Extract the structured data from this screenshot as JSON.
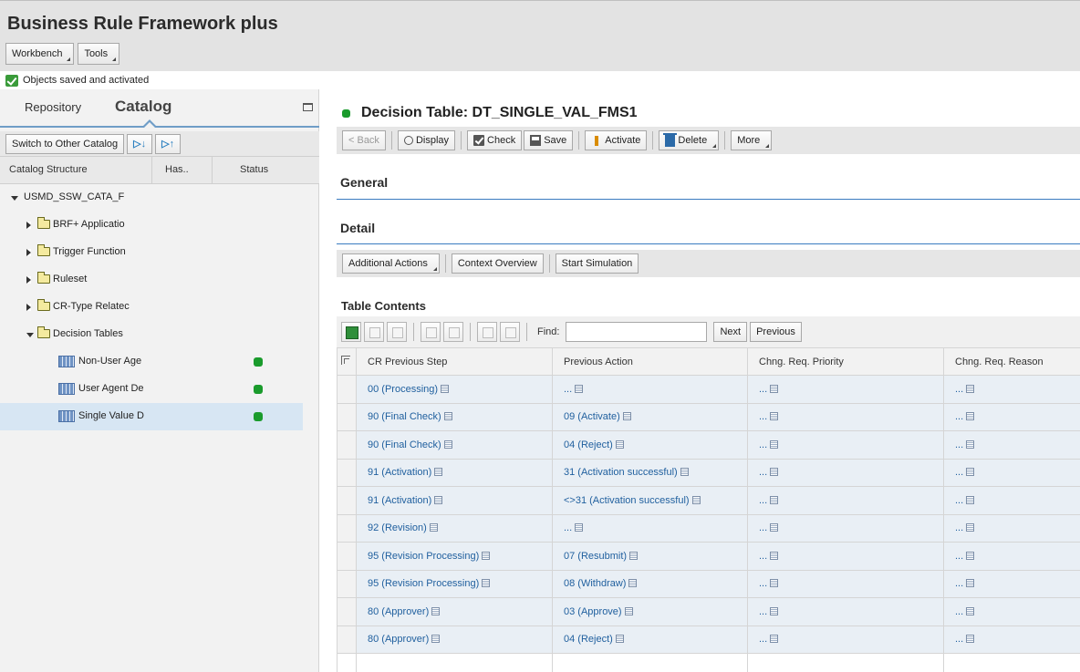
{
  "app": {
    "title": "Business Rule Framework plus",
    "menus": [
      "Workbench",
      "Tools"
    ],
    "status_message": "Objects saved and activated"
  },
  "left": {
    "tab_repository": "Repository",
    "tab_catalog": "Catalog",
    "switch_catalog_label": "Switch to Other Catalog",
    "columns": {
      "structure": "Catalog Structure",
      "has": "Has..",
      "status": "Status"
    },
    "tree": {
      "root": "USMD_SSW_CATA_F",
      "folders": [
        "BRF+ Applicatio",
        "Trigger Function",
        "Ruleset",
        "CR-Type Relatec",
        "Decision Tables"
      ],
      "tables": [
        "Non-User Age",
        "User Agent Dе",
        "Single Value D"
      ]
    }
  },
  "right": {
    "doc_title": "Decision Table: DT_SINGLE_VAL_FMS1",
    "toolbar": {
      "back": "< Back",
      "display": "Display",
      "check": "Check",
      "save": "Save",
      "activate": "Activate",
      "delete": "Delete",
      "more": "More"
    },
    "section_general": "General",
    "section_detail": "Detail",
    "detail_toolbar": {
      "additional_actions": "Additional Actions",
      "context_overview": "Context Overview",
      "start_simulation": "Start Simulation"
    },
    "table_contents_title": "Table Contents",
    "find_label": "Find:",
    "find_value": "",
    "next_label": "Next",
    "previous_label": "Previous",
    "table": {
      "headers": [
        "CR Previous Step",
        "Previous Action",
        "Chng. Req. Priority",
        "Chng. Req. Reason"
      ],
      "rows": [
        [
          "00 (Processing)",
          "...",
          "...",
          "..."
        ],
        [
          "90 (Final Check)",
          "09 (Activate)",
          "...",
          "..."
        ],
        [
          "90 (Final Check)",
          "04 (Reject)",
          "...",
          "..."
        ],
        [
          "91 (Activation)",
          "31 (Activation successful)",
          "...",
          "..."
        ],
        [
          "91 (Activation)",
          "<>31 (Activation successful)",
          "...",
          "..."
        ],
        [
          "92 (Revision)",
          "...",
          "...",
          "..."
        ],
        [
          "95 (Revision Processing)",
          "07 (Resubmit)",
          "...",
          "..."
        ],
        [
          "95 (Revision Processing)",
          "08 (Withdraw)",
          "...",
          "..."
        ],
        [
          "80 (Approver)",
          "03 (Approve)",
          "...",
          "..."
        ],
        [
          "80 (Approver)",
          "04 (Reject)",
          "...",
          "..."
        ]
      ]
    }
  }
}
